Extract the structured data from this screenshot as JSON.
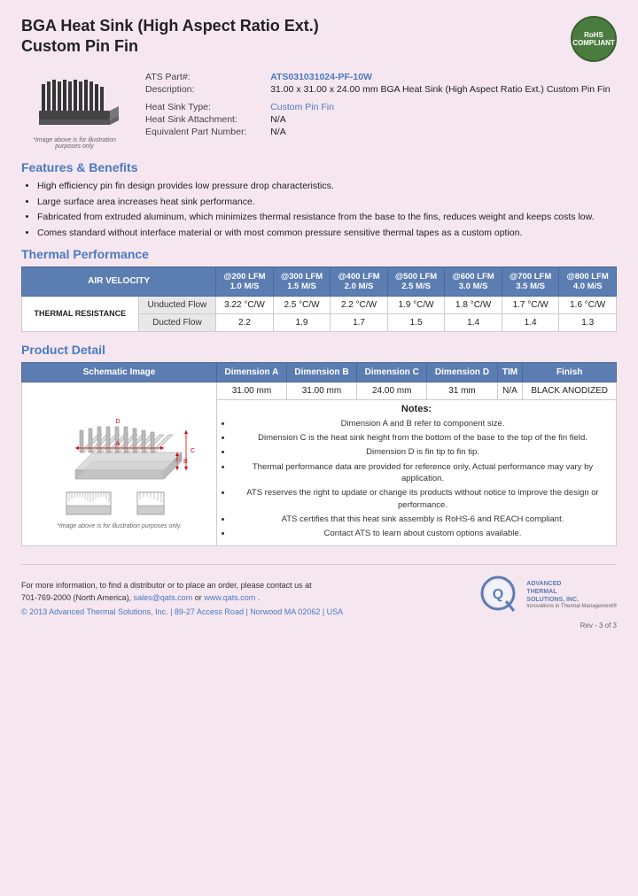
{
  "header": {
    "title_line1": "BGA Heat Sink (High Aspect Ratio Ext.)",
    "title_line2": "Custom Pin Fin",
    "rohs_line1": "RoHS",
    "rohs_line2": "COMPLIANT"
  },
  "product": {
    "ats_part_label": "ATS Part#:",
    "ats_part_value": "ATS031031024-PF-10W",
    "description_label": "Description:",
    "description_value": "31.00 x 31.00 x 24.00 mm  BGA Heat Sink (High Aspect Ratio Ext.) Custom Pin Fin",
    "heat_sink_type_label": "Heat Sink Type:",
    "heat_sink_type_value": "Custom Pin Fin",
    "heat_sink_attachment_label": "Heat Sink Attachment:",
    "heat_sink_attachment_value": "N/A",
    "equivalent_part_label": "Equivalent Part Number:",
    "equivalent_part_value": "N/A",
    "image_caption": "*Image above is for illustration purposes only"
  },
  "features": {
    "section_title": "Features & Benefits",
    "items": [
      "High efficiency pin fin design provides low pressure drop characteristics.",
      "Large surface area increases heat sink performance.",
      "Fabricated from extruded aluminum, which minimizes thermal resistance from the base to the fins, reduces weight and keeps costs low.",
      "Comes standard without interface material or with most common pressure sensitive thermal tapes as a custom option."
    ]
  },
  "thermal_performance": {
    "section_title": "Thermal Performance",
    "header_col1": "AIR VELOCITY",
    "columns": [
      "@200 LFM\n1.0 M/S",
      "@300 LFM\n1.5 M/S",
      "@400 LFM\n2.0 M/S",
      "@500 LFM\n2.5 M/S",
      "@600 LFM\n3.0 M/S",
      "@700 LFM\n3.5 M/S",
      "@800 LFM\n4.0 M/S"
    ],
    "row_label": "THERMAL RESISTANCE",
    "unducted_label": "Unducted Flow",
    "unducted_values": [
      "3.22 °C/W",
      "2.5 °C/W",
      "2.2 °C/W",
      "1.9 °C/W",
      "1.8 °C/W",
      "1.7 °C/W",
      "1.6 °C/W"
    ],
    "ducted_label": "Ducted Flow",
    "ducted_values": [
      "2.2",
      "1.9",
      "1.7",
      "1.5",
      "1.4",
      "1.4",
      "1.3"
    ]
  },
  "product_detail": {
    "section_title": "Product Detail",
    "columns": [
      "Schematic Image",
      "Dimension A",
      "Dimension B",
      "Dimension C",
      "Dimension D",
      "TIM",
      "Finish"
    ],
    "dim_a": "31.00 mm",
    "dim_b": "31.00 mm",
    "dim_c": "24.00 mm",
    "dim_d": "31 mm",
    "tim": "N/A",
    "finish": "BLACK ANODIZED",
    "schematic_caption": "*Image above is for illustration purposes only.",
    "notes_title": "Notes:",
    "notes": [
      "Dimension A and B refer to component size.",
      "Dimension C is the heat sink height from the bottom of the base to the top of the fin field.",
      "Dimension D is fin tip to fin tip.",
      "Thermal performance data are provided for reference only. Actual performance may vary by application.",
      "ATS reserves the right to update or change its products without notice to improve the design or performance.",
      "ATS certifies that this heat sink assembly is RoHS-6 and REACH compliant.",
      "Contact ATS to learn about custom options available."
    ]
  },
  "footer": {
    "info_text": "For more information, to find a distributor or to place an order, please contact us at\n701-769-2000 (North America),",
    "email": "sales@qats.com",
    "or_text": "or",
    "website": "www.qats.com",
    "copyright": "© 2013 Advanced Thermal Solutions, Inc.  |  89-27 Access Road  |  Norwood MA  02062  |  USA",
    "ats_name1": "ADVANCED",
    "ats_name2": "THERMAL",
    "ats_name3": "SOLUTIONS, INC.",
    "ats_tagline": "Innovations in Thermal Management®",
    "page_number": "Rev - 3 of 3"
  }
}
